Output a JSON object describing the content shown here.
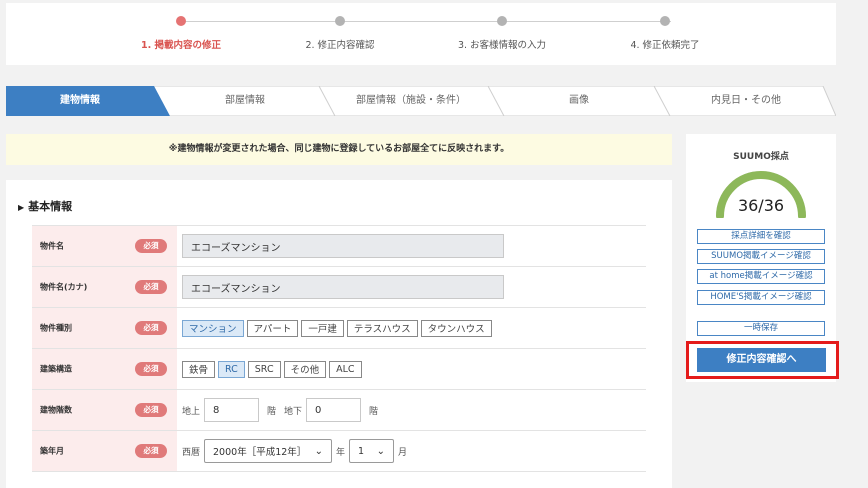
{
  "progress": {
    "steps": [
      {
        "label": "1. 掲載内容の修正",
        "active": true
      },
      {
        "label": "2. 修正内容確認",
        "active": false
      },
      {
        "label": "3. お客様情報の入力",
        "active": false
      },
      {
        "label": "4. 修正依頼完了",
        "active": false
      }
    ]
  },
  "tabs": [
    {
      "label": "建物情報",
      "active": true
    },
    {
      "label": "部屋情報",
      "active": false
    },
    {
      "label": "部屋情報（施設・条件）",
      "active": false
    },
    {
      "label": "画像",
      "active": false
    },
    {
      "label": "内見日・その他",
      "active": false
    }
  ],
  "notice": "※建物情報が変更された場合、同じ建物に登録しているお部屋全てに反映されます。",
  "section": {
    "title": "基本情報",
    "marker": "▶"
  },
  "required_label": "必須",
  "form": {
    "property_name": {
      "label": "物件名",
      "value": "エコーズマンション"
    },
    "property_kana": {
      "label": "物件名(カナ)",
      "value": "エコーズマンション"
    },
    "property_type": {
      "label": "物件種別",
      "options": [
        "マンション",
        "アパート",
        "一戸建",
        "テラスハウス",
        "タウンハウス"
      ],
      "selected": "マンション"
    },
    "structure": {
      "label": "建築構造",
      "options": [
        "鉄骨",
        "RC",
        "SRC",
        "その他",
        "ALC"
      ],
      "selected": "RC"
    },
    "floors": {
      "label": "建物階数",
      "above_label": "地上",
      "above_value": "8",
      "below_label": "地下",
      "below_value": "0",
      "unit": "階"
    },
    "built": {
      "label": "築年月",
      "era_label": "西暦",
      "year_value": "2000年［平成12年］",
      "year_unit": "年",
      "month_value": "1",
      "month_unit": "月"
    }
  },
  "side": {
    "score_title": "SUUMO採点",
    "score": 36,
    "score_max": 36,
    "score_text": "36/36",
    "gauge_color": "#8db85a",
    "buttons": [
      "採点詳細を確認",
      "SUUMO掲載イメージ確認",
      "at home掲載イメージ確認",
      "HOME'S掲載イメージ確認"
    ],
    "save_label": "一時保存",
    "confirm_label": "修正内容確認へ"
  }
}
